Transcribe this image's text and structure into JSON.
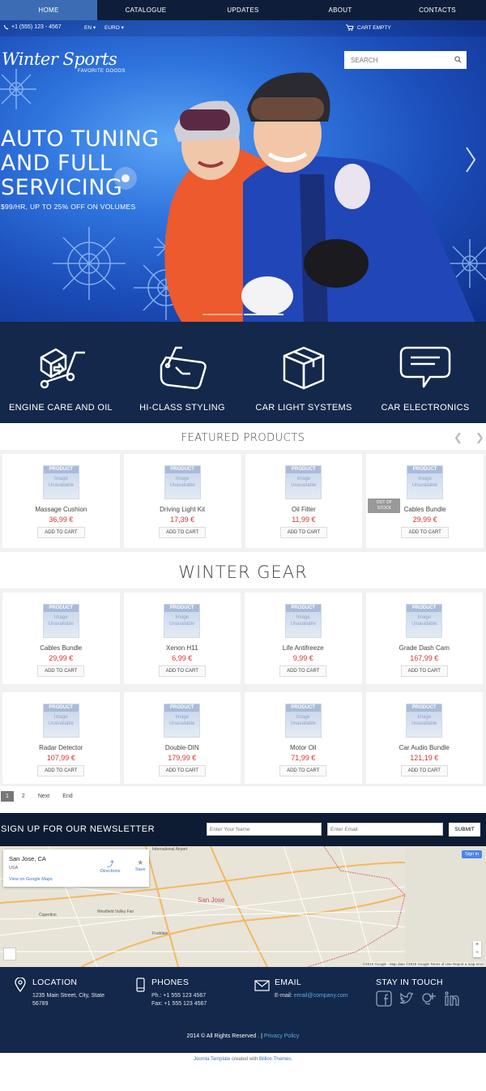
{
  "nav": {
    "items": [
      "HOME",
      "CATALOGUE",
      "UPDATES",
      "ABOUT",
      "CONTACTS"
    ]
  },
  "topbar": {
    "phone": "+1 (555) 123 - 4567",
    "language": "EN",
    "currency": "EURO",
    "cart": "CART EMPTY"
  },
  "search": {
    "placeholder": "SEARCH"
  },
  "logo": {
    "title": "Winter Sports",
    "tagline": "FAVORITE GOODS"
  },
  "slide": {
    "title_line1": "AUTO TUNING",
    "title_line2": "AND FULL",
    "title_line3": "SERVICING",
    "subtitle": "$99/HR, UP TO 25% OFF ON VOLUMES"
  },
  "services": [
    {
      "label": "ENGINE CARE AND OIL",
      "icon": "hand-truck-icon"
    },
    {
      "label": "HI-CLASS STYLING",
      "icon": "clock-tag-icon"
    },
    {
      "label": "CAR LIGHT SYSTEMS",
      "icon": "box-icon"
    },
    {
      "label": "CAR ELECTRONICS",
      "icon": "speech-bubble-icon"
    }
  ],
  "placeholder_image": {
    "top": "PRODUCT",
    "line1": "Image",
    "line2": "Unavailable"
  },
  "featured": {
    "title": "FEATURED PRODUCTS",
    "products": [
      {
        "name": "Massage Cushion",
        "price": "36,99 €",
        "button": "ADD TO CART"
      },
      {
        "name": "Driving Light Kit",
        "price": "17,39 €",
        "button": "ADD TO CART"
      },
      {
        "name": "Oil Filter",
        "price": "11,99 €",
        "button": "ADD TO CART"
      },
      {
        "name": "Cables Bundle",
        "price": "29,99 €",
        "button": "ADD TO CART",
        "badge_line1": "OUT OF",
        "badge_line2": "STOCK"
      }
    ]
  },
  "gear": {
    "title": "WINTER GEAR",
    "products": [
      {
        "name": "Cables Bundle",
        "price": "29,99 €",
        "button": "ADD TO CART"
      },
      {
        "name": "Xenon H11",
        "price": "6,99 €",
        "button": "ADD TO CART"
      },
      {
        "name": "Life Antifreeze",
        "price": "9,99 €",
        "button": "ADD TO CART"
      },
      {
        "name": "Grade Dash Cam",
        "price": "167,99 €",
        "button": "ADD TO CART"
      },
      {
        "name": "Radar Detector",
        "price": "107,99 €",
        "button": "ADD TO CART"
      },
      {
        "name": "Double-DIN",
        "price": "179,99 €",
        "button": "ADD TO CART"
      },
      {
        "name": "Motor Oil",
        "price": "71,99 €",
        "button": "ADD TO CART"
      },
      {
        "name": "Car Audio Bundle",
        "price": "121,19 €",
        "button": "ADD TO CART"
      }
    ]
  },
  "pagination": {
    "pages": [
      "1",
      "2"
    ],
    "next": "Next",
    "end": "End"
  },
  "newsletter": {
    "label": "SIGN UP FOR OUR NEWSLETTER",
    "name_placeholder": "Enter Your Name",
    "email_placeholder": "Enter Email",
    "submit": "SUBMIT"
  },
  "map": {
    "place": "San Jose, CA",
    "country": "USA",
    "view_link": "View on Google Maps",
    "directions": "Directions",
    "save": "Save",
    "signin": "Sign in",
    "credit": "©2015 Google - Map data ©2015 Google   Terms of Use   Report a map error",
    "city": "San Jose",
    "label_cupertino": "Cupertino",
    "label_westfield": "Westfield Valley Fair",
    "label_airport": "International Airport",
    "label_fruitdale": "Fruitdale"
  },
  "footer": {
    "location": {
      "title": "LOCATION",
      "line1": "1235 Main Street, City, State",
      "line2": "56789"
    },
    "phones": {
      "title": "PHONES",
      "line1": "Ph.: +1 555 123 4567",
      "line2": "Fax: +1 555 123 4567"
    },
    "email": {
      "title": "EMAIL",
      "label": "E-mail:",
      "address": "email@company.com"
    },
    "social": {
      "title": "STAY IN TOUCH"
    },
    "copyright": "2014 © All Rights Reserved . |",
    "privacy": "Privacy Policy",
    "credit_link": "Joomla Template",
    "credit_mid": "created with",
    "credit_company": "Billion Themes."
  },
  "colors": {
    "nav": "#0e1e3a",
    "active": "#3c6cb4",
    "dark": "#13284a",
    "price": "#dd3333"
  }
}
